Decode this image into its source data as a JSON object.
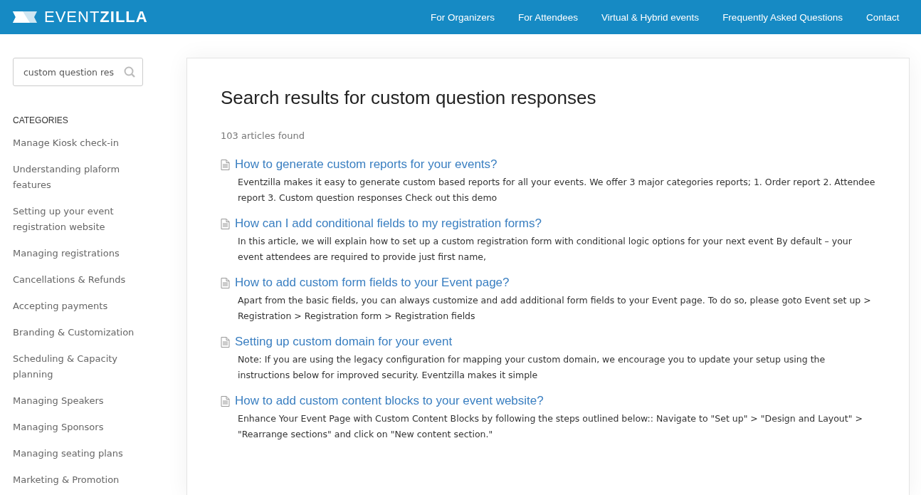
{
  "header": {
    "logo": "EVENT**ZILLA**",
    "nav": [
      {
        "label": "For Organizers"
      },
      {
        "label": "For Attendees"
      },
      {
        "label": "Virtual & Hybrid events"
      },
      {
        "label": "Frequently Asked Questions"
      },
      {
        "label": "Contact"
      }
    ]
  },
  "sidebar": {
    "search": {
      "value": "custom question res"
    },
    "categories_title": "CATEGORIES",
    "categories": [
      {
        "label": "Manage Kiosk check-in"
      },
      {
        "label": "Understanding plaform features"
      },
      {
        "label": "Setting up your event registration website"
      },
      {
        "label": "Managing registrations"
      },
      {
        "label": "Cancellations & Refunds"
      },
      {
        "label": "Accepting payments"
      },
      {
        "label": "Branding & Customization"
      },
      {
        "label": "Scheduling & Capacity planning"
      },
      {
        "label": "Managing Speakers"
      },
      {
        "label": "Managing Sponsors"
      },
      {
        "label": "Managing seating plans"
      },
      {
        "label": "Marketing & Promotion"
      }
    ]
  },
  "main": {
    "title": "Search results for custom question responses",
    "count": "103 articles found",
    "results": [
      {
        "title": "How to generate custom reports for your events?",
        "snippet": "Eventzilla makes it easy to generate custom based reports for all your events. We offer 3 major categories reports; 1. Order report 2. Attendee report 3. Custom question responses Check out this demo"
      },
      {
        "title": "How can I add conditional fields to my registration forms?",
        "snippet": "In this article, we will explain how to set up a custom registration form with conditional logic options for your next event By default – your event attendees are required to provide just first name,"
      },
      {
        "title": "How to add custom form fields to your Event page?",
        "snippet": "Apart from the basic fields, you can always customize and add additional form fields to your Event page. To do so, please goto Event set up > Registration > Registration form > Registration fields"
      },
      {
        "title": "Setting up custom domain for your event",
        "snippet": "Note: If you are using the legacy configuration for mapping your custom domain, we encourage you to update your setup using the instructions below for improved security. Eventzilla makes it simple"
      },
      {
        "title": "How to add custom content blocks to your event website?",
        "snippet": "Enhance Your Event Page with Custom Content Blocks by following the steps outlined below:: Navigate to \"Set up\" > \"Design and Layout\" > \"Rearrange sections\" and click on \"New content section.\""
      }
    ]
  }
}
